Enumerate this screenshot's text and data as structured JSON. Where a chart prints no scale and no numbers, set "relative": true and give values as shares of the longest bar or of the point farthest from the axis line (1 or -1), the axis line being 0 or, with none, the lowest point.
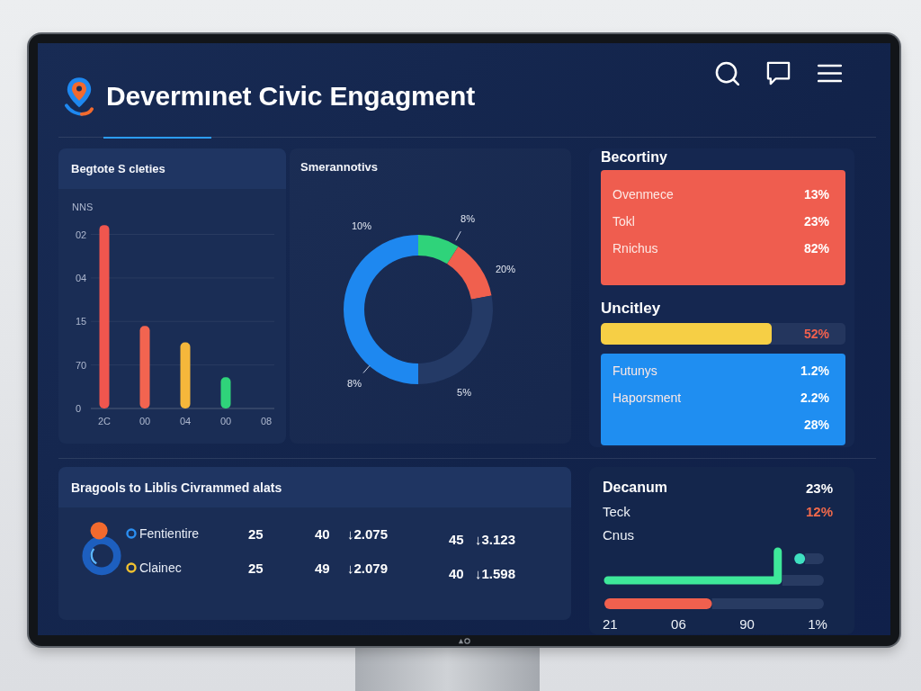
{
  "header": {
    "title": "Devermınet Civic Engagment"
  },
  "bar_panel": {
    "title": "Begtote S cleties",
    "tick_labels": [
      "02",
      "04",
      "15",
      "70",
      "0"
    ],
    "chart_data": {
      "type": "bar",
      "relative": true,
      "ylabel": "NNS",
      "categories": [
        "2C",
        "00",
        "04",
        "00",
        "08"
      ],
      "values": [
        1,
        0.45,
        0.36,
        0.17,
        null
      ],
      "colors": [
        "#f0564e",
        "#f26450",
        "#f5b73b",
        "#2fd37a",
        null
      ]
    }
  },
  "donut_panel": {
    "title": "Smerannotivs",
    "chart_data": {
      "type": "donut",
      "values": [
        9,
        13,
        28,
        50
      ],
      "colors": [
        "#2fd37a",
        "#f0604e",
        "#243a66",
        "#1e88f0"
      ]
    },
    "labels": [
      {
        "text": "10%",
        "leader": false
      },
      {
        "text": "8%",
        "leader": true
      },
      {
        "text": "20%",
        "leader": false
      },
      {
        "text": "8%",
        "leader": true
      },
      {
        "text": "5%",
        "leader": false
      }
    ]
  },
  "side_panel": {
    "title": "Becortiny",
    "sections": [
      {
        "kind": "card",
        "color": "#ef5d4f",
        "rows": [
          {
            "label": "Ovenmece",
            "value": "13%"
          },
          {
            "label": "Tokl",
            "value": "23%"
          },
          {
            "label": "Rnichus",
            "value": "82%"
          }
        ]
      },
      {
        "kind": "heading",
        "text": "Uncitley"
      },
      {
        "kind": "progress",
        "level": 0.7,
        "reading": "52%"
      },
      {
        "kind": "card",
        "color": "#1f8ef1",
        "rows": [
          {
            "label": "Futunys",
            "value": "1.2%"
          },
          {
            "label": "Haporsment",
            "value": "2.2%"
          },
          {
            "value": "28%"
          }
        ]
      }
    ]
  },
  "table_panel": {
    "title": "Bragools to Liblis Civrammed alats",
    "rows": [
      {
        "label": "Fentientire",
        "color": "#2b8ff2",
        "cells": [
          "25",
          "40",
          "↓2.075",
          "45",
          "↓3.123"
        ]
      },
      {
        "label": "Clainec",
        "color": "#f2c230",
        "cells": [
          "25",
          "49",
          "↓2.079",
          "40",
          "↓1.598"
        ]
      }
    ]
  },
  "trend_panel": {
    "title": "Decanum",
    "labels": [
      "Teck",
      "Cnus"
    ],
    "values": [
      {
        "text": "23%",
        "color": "#ffffff"
      },
      {
        "text": "12%",
        "color": "#f26a4b"
      }
    ],
    "meters": [
      {
        "kind": "dot",
        "level": 0.89,
        "color": "#3fe0c0"
      },
      {
        "kind": "line",
        "level": 0.79,
        "color": "#3ee89a"
      },
      {
        "kind": "bar",
        "level": 0.49,
        "color": "#f0604e"
      }
    ],
    "axis_labels": [
      "21",
      "06",
      "90",
      "1%"
    ]
  }
}
